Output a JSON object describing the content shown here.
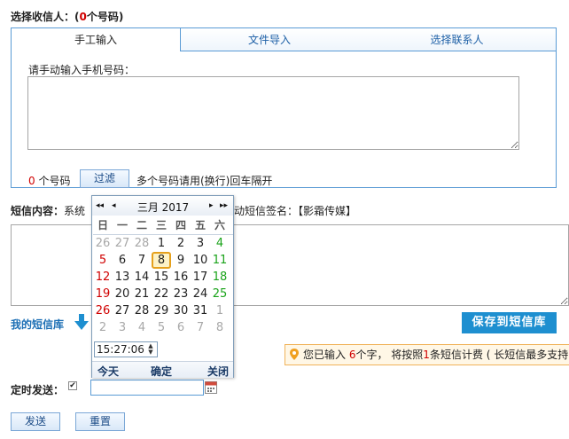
{
  "recipients": {
    "label_prefix": "选择收信人：(",
    "count": "0",
    "label_suffix": "个号码)",
    "tabs": [
      {
        "label": "手工输入"
      },
      {
        "label": "文件导入"
      },
      {
        "label": "选择联系人"
      }
    ],
    "manual_prompt": "请手动输入手机号码：",
    "number_count": "0",
    "number_count_unit": " 个号码",
    "filter_label": "过滤",
    "hint": "多个号码请用(换行)回车隔开"
  },
  "message": {
    "label": "短信内容：",
    "pre_text": "系统",
    "signature_text": "动短信签名：【影霜传媒】"
  },
  "library": {
    "label": "我的短信库",
    "save_label": "保存到短信库"
  },
  "counter": {
    "prefix": "您已输入 ",
    "chars": "6",
    "mid": "个字，  将按照",
    "sms": "1",
    "suffix": "条短信计费 ( 长短信最多支持"
  },
  "schedule": {
    "label": "定时发送：",
    "date_value": ""
  },
  "actions": {
    "send_label": "发送",
    "reset_label": "重置"
  },
  "calendar": {
    "title": "三月 2017",
    "nav": {
      "prev_year": "◂◂",
      "prev_month": "◂",
      "next_month": "▸",
      "next_year": "▸▸"
    },
    "weekdays": [
      "日",
      "一",
      "二",
      "三",
      "四",
      "五",
      "六"
    ],
    "weeks": [
      [
        "26",
        "27",
        "28",
        "1",
        "2",
        "3",
        "4"
      ],
      [
        "5",
        "6",
        "7",
        "8",
        "9",
        "10",
        "11"
      ],
      [
        "12",
        "13",
        "14",
        "15",
        "16",
        "17",
        "18"
      ],
      [
        "19",
        "20",
        "21",
        "22",
        "23",
        "24",
        "25"
      ],
      [
        "26",
        "27",
        "28",
        "29",
        "30",
        "31",
        "1"
      ],
      [
        "2",
        "3",
        "4",
        "5",
        "6",
        "7",
        "8"
      ]
    ],
    "selected": "8",
    "time": "15:27:06",
    "today_label": "今天",
    "ok_label": "确定",
    "close_label": "关闭"
  },
  "colors": {
    "accent": "#1e8fd0",
    "border": "#5a9bd5",
    "weekend_red": "#d00000",
    "weekend_green": "#1aa31a"
  }
}
